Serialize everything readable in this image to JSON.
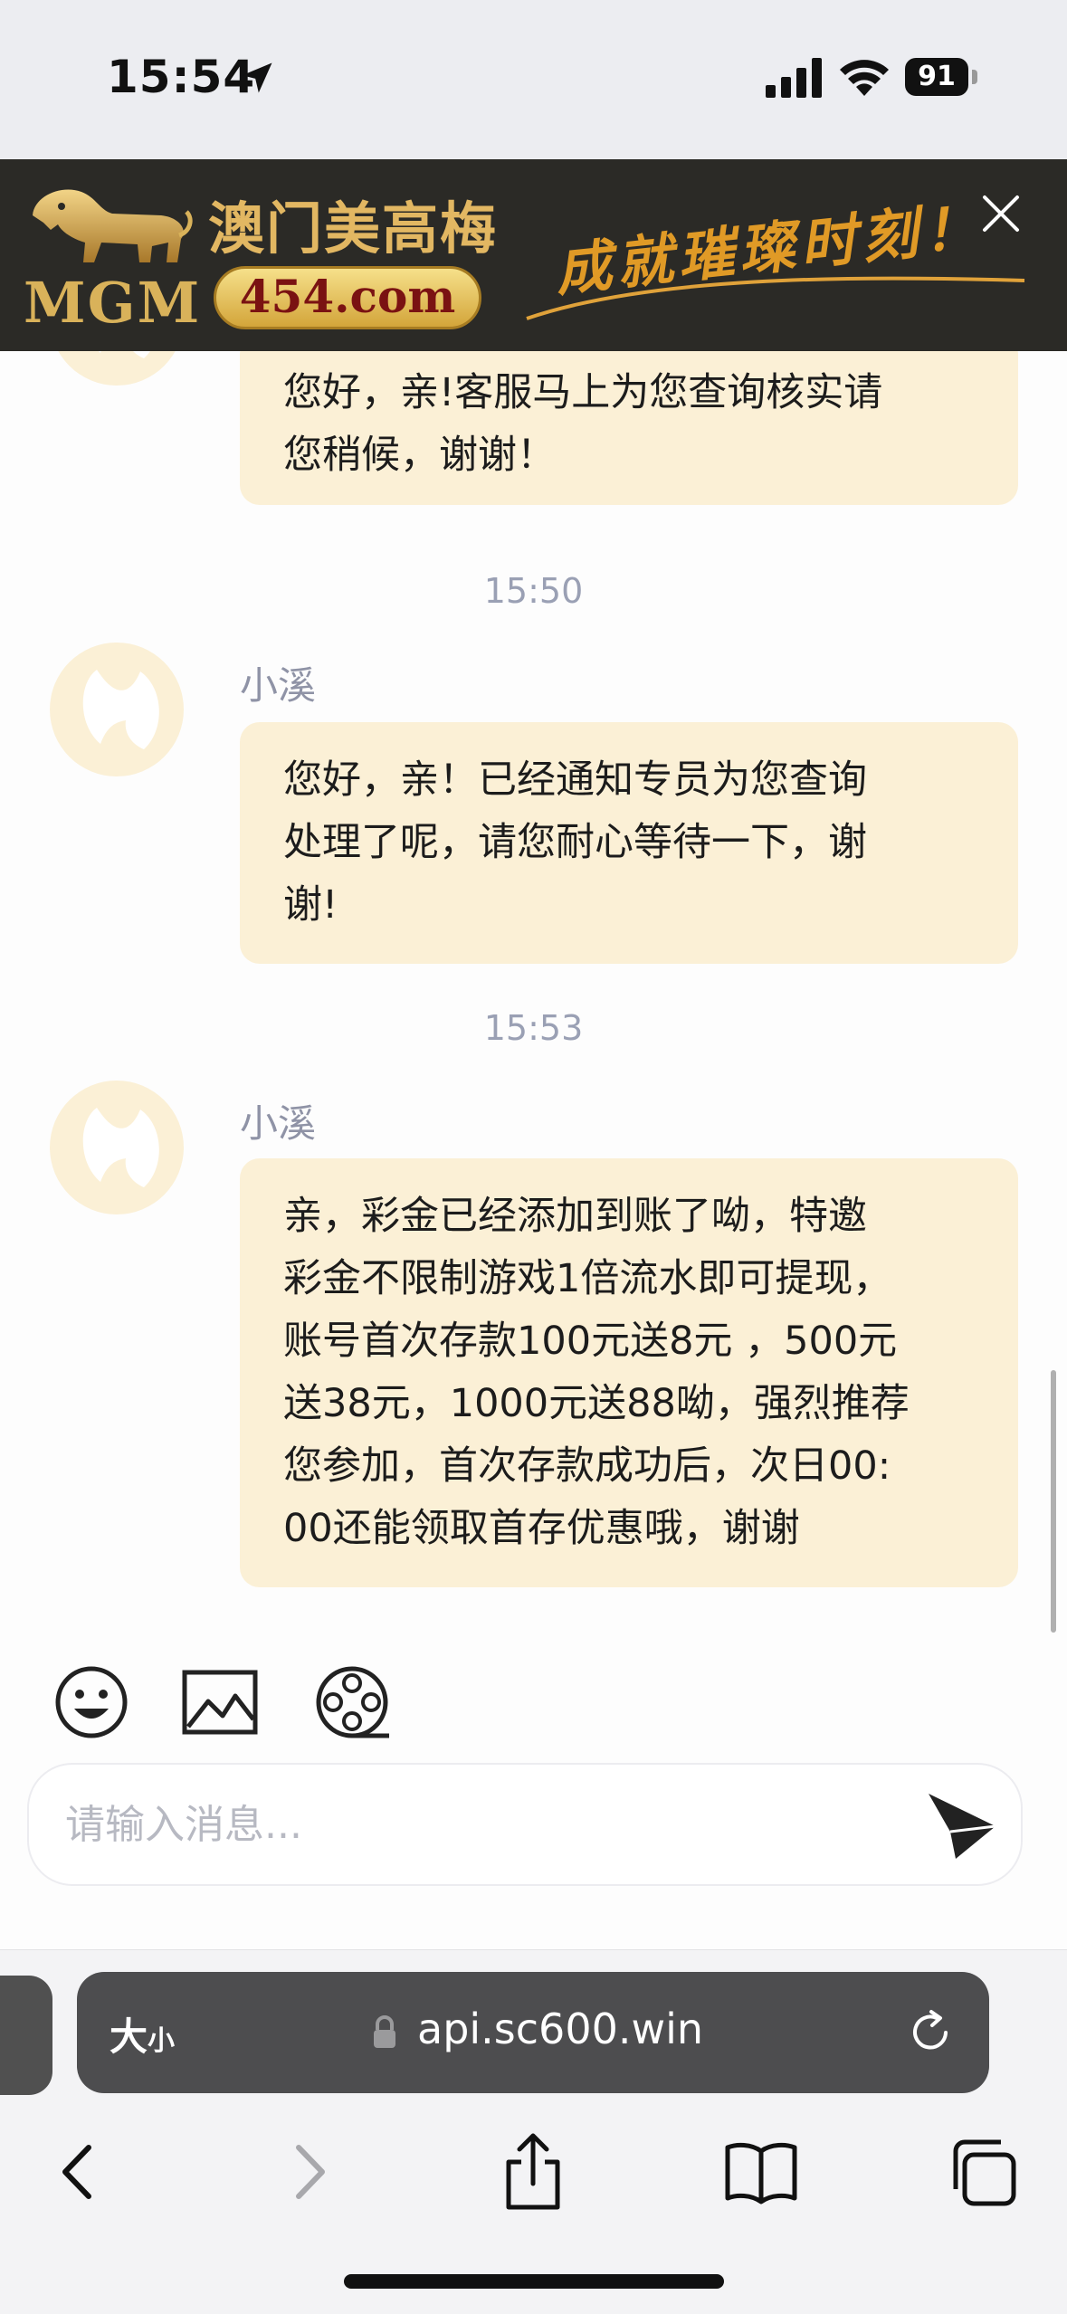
{
  "status_bar": {
    "time": "15:54",
    "battery": "91",
    "icons": [
      "location-arrow-icon",
      "signal-icon",
      "wifi-icon",
      "battery-icon"
    ]
  },
  "ad_banner": {
    "brand_en": "MGM",
    "brand_cn": "澳门美高梅",
    "domain": "454.com",
    "slogan": "成就璀璨时刻！",
    "colors": {
      "background": "#2b2a26",
      "gold": "#e2b762",
      "slogan": "#e09a26"
    }
  },
  "chat": {
    "messages": [
      {
        "text": "您好，亲!客服马上为您查询核实请\n您稍候，谢谢！"
      },
      {
        "time": "15:50",
        "sender": "小溪",
        "text": "您好，亲！已经通知专员为您查询\n处理了呢，请您耐心等待一下，谢\n谢!"
      },
      {
        "time": "15:53",
        "sender": "小溪",
        "text": "亲，彩金已经添加到账了呦，特邀\n彩金不限制游戏1倍流水即可提现，\n账号首次存款100元送8元 ，500元\n送38元，1000元送88呦，强烈推荐\n您参加，首次存款成功后，次日00:\n00还能领取首存优惠哦，谢谢"
      }
    ],
    "colors": {
      "bubble": "#fbf0d6",
      "meta_text": "#8f93a6"
    }
  },
  "toolbar": {
    "icons": [
      "emoji-icon",
      "image-icon",
      "video-reel-icon"
    ]
  },
  "input": {
    "placeholder": "请输入消息...",
    "value": ""
  },
  "safari": {
    "text_size_big": "大",
    "text_size_small": "小",
    "url": "api.sc600.win",
    "nav_icons": [
      "back-icon",
      "forward-icon",
      "share-icon",
      "bookmarks-icon",
      "tabs-icon"
    ]
  }
}
